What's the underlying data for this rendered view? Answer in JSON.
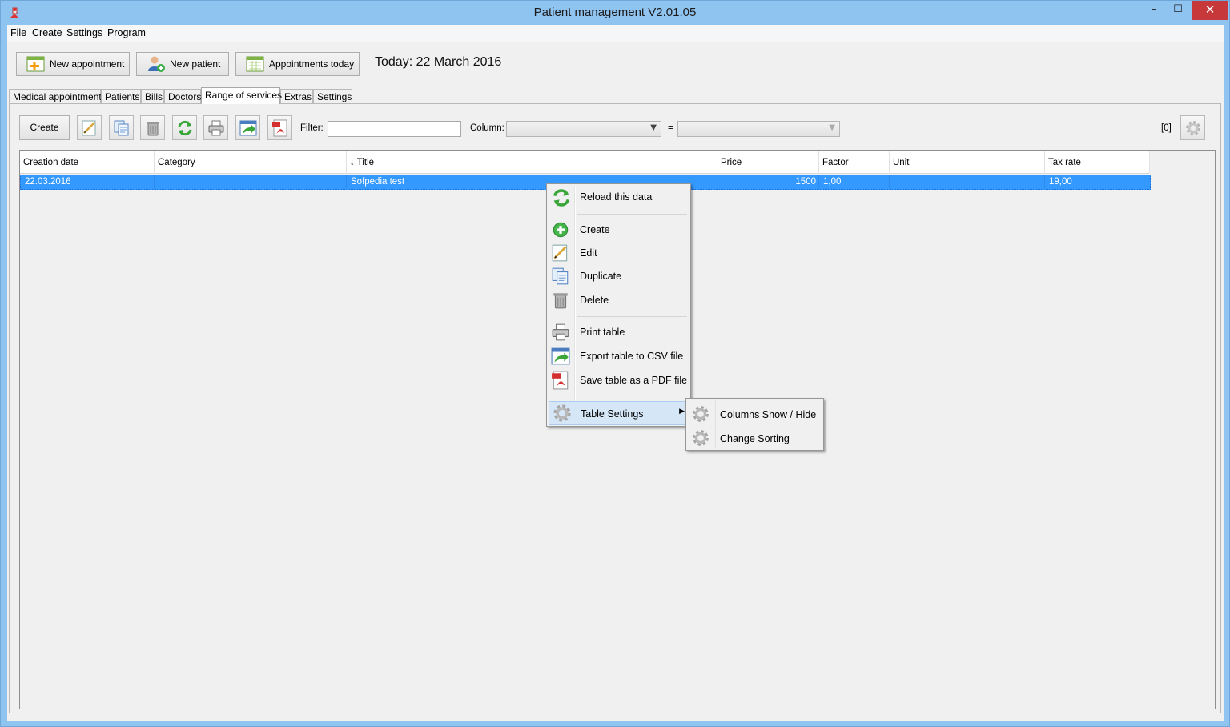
{
  "window": {
    "title": "Patient management V2.01.05",
    "minimize": "–",
    "maximize": "☐",
    "close": "✕"
  },
  "menu": {
    "file": "File",
    "create": "Create",
    "settings": "Settings",
    "program": "Program"
  },
  "toolbar": {
    "new_appointment": "New appointment",
    "new_patient": "New patient",
    "appointments_today": "Appointments today",
    "today": "Today: 22 March 2016"
  },
  "tabs": {
    "medical_appointments": "Medical appointments",
    "patients": "Patients",
    "bills": "Bills",
    "doctors": "Doctors",
    "range_of_services": "Range of services",
    "extras": "Extras",
    "settings": "Settings"
  },
  "panel": {
    "create_label": "Create",
    "filter_label": "Filter:",
    "filter_value": "",
    "column_label": "Column:",
    "column_value": "",
    "equals": "=",
    "value_select": "",
    "count": "[0]"
  },
  "table": {
    "headers": {
      "creation_date": "Creation date",
      "category": "Category",
      "title": "↓ Title",
      "price": "Price",
      "factor": "Factor",
      "unit": "Unit",
      "tax_rate": "Tax rate"
    },
    "rows": [
      {
        "creation_date": "22.03.2016",
        "category": "",
        "title": "Sofpedia test",
        "price": "1500",
        "factor": "1,00",
        "unit": "",
        "tax_rate": "19,00"
      }
    ]
  },
  "context_menu": {
    "reload": "Reload this data",
    "create": "Create",
    "edit": "Edit",
    "duplicate": "Duplicate",
    "delete": "Delete",
    "print": "Print table",
    "export_csv": "Export table to CSV file",
    "save_pdf": "Save table as a PDF file",
    "table_settings": "Table Settings"
  },
  "submenu": {
    "columns": "Columns Show / Hide",
    "sorting": "Change Sorting"
  },
  "colors": {
    "selection": "#3399ff",
    "menu_highlight": "#d5e6f7",
    "close_button": "#c7383a"
  }
}
